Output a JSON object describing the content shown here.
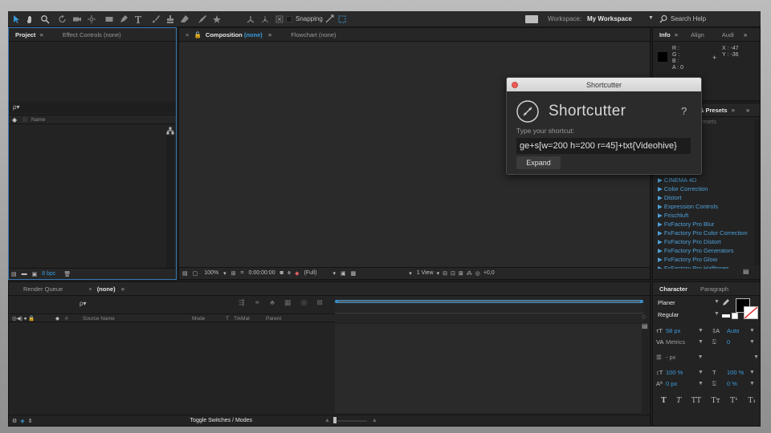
{
  "toolbar": {
    "snapping_label": "Snapping",
    "workspace_label": "Workspace:",
    "workspace_value": "My Workspace",
    "search_placeholder": "Search Help"
  },
  "project_panel": {
    "tabs": [
      {
        "label": "Project",
        "menu": "≡"
      },
      {
        "label": "Effect Controls (none)"
      }
    ],
    "search_glyph": "ρ▾",
    "column_name": "Name",
    "bpc_label": "8 bpc"
  },
  "composition_panel": {
    "close_glyph": "×",
    "comp_prefix": "Composition",
    "comp_name": "(none)",
    "menu": "≡",
    "flowchart_tab": "Flowchart (none)",
    "zoom": "100%",
    "timecode": "0:00:00:00",
    "resolution": "(Full)",
    "view_count": "1 View",
    "exposure": "+0,0"
  },
  "info_panel": {
    "tabs": [
      "Info",
      "Align",
      "Audi"
    ],
    "menu": "≡",
    "channels": [
      "R :",
      "G :",
      "B :",
      "A : 0"
    ],
    "x_readout": "X : -47",
    "y_readout": "Y : -36"
  },
  "effects_panel": {
    "title_partial": "& Presets",
    "menu": "≡",
    "presets_partial": "resets",
    "items": [
      "▶ CINEMA 4D",
      "▶ Color Correction",
      "▶ Distort",
      "▶ Expression Controls",
      "▶ Frischluft",
      "▶ FxFactory Pro Blur",
      "▶ FxFactory Pro Color Correction",
      "▶ FxFactory Pro Distort",
      "▶ FxFactory Pro Generators",
      "▶ FxFactory Pro Glow",
      "▶ FxFactory Pro Halftones"
    ]
  },
  "timeline": {
    "tabs": [
      {
        "label": "Render Queue"
      },
      {
        "label": "(none)",
        "close": "×",
        "menu": "≡"
      }
    ],
    "search_glyph": "ρ▾",
    "columns": [
      "#",
      "Source Name",
      "Mode",
      "T",
      "TrkMat",
      "Parent"
    ],
    "toggle_label": "Toggle Switches / Modes"
  },
  "character_panel": {
    "tabs": [
      "Character",
      "Paragraph"
    ],
    "menu": "≡",
    "font_family": "Planer",
    "font_style": "Regular",
    "font_size": "58 px",
    "leading": "Auto",
    "kerning": "Metrics",
    "tracking": "0",
    "stroke_width": "- px",
    "vertical_scale": "100 %",
    "horizontal_scale": "100 %",
    "baseline_shift": "0 px",
    "tsume": "0 %",
    "type_styles": [
      "T",
      "T",
      "TT",
      "Tт",
      "T¹",
      "T₁"
    ]
  },
  "dialog": {
    "title": "Shortcutter",
    "heading": "Shortcutter",
    "help": "?",
    "prompt": "Type your shortcut:",
    "input_value": "ge+s[w=200 h=200 r=45]+txt{Videohive}",
    "expand_label": "Expand"
  },
  "colors": {
    "accent_blue": "#3a9bdc",
    "close_red": "#ec5a55",
    "panel_bg": "#232323"
  }
}
